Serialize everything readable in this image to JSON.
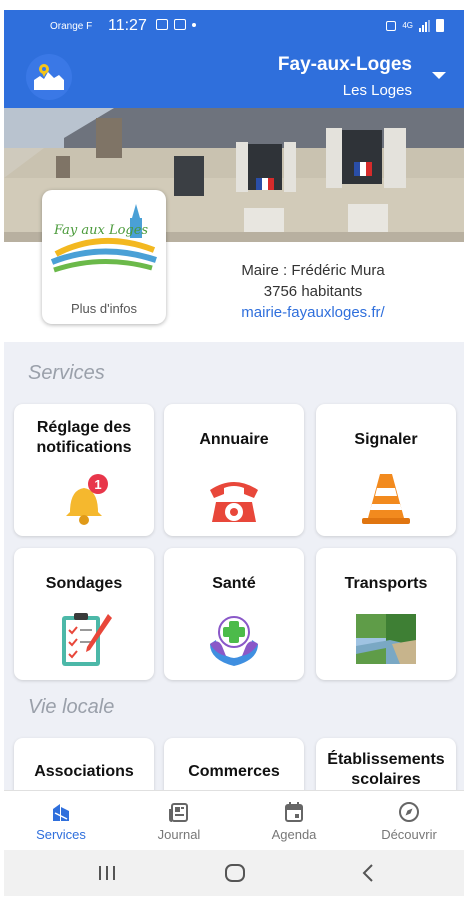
{
  "status_bar": {
    "carrier": "Orange F",
    "time": "11:27",
    "network": "4G"
  },
  "header": {
    "city": "Fay-aux-Loges",
    "subtitle": "Les Loges",
    "accent_color": "#2f6fdc"
  },
  "commune": {
    "logo_text": "Fay aux Loges",
    "more_info_label": "Plus d'infos",
    "mayor": "Maire : Frédéric Mura",
    "population": "3756 habitants",
    "website": "mairie-fayauxloges.fr/"
  },
  "services": {
    "title": "Services",
    "tiles": [
      {
        "label": "Réglage des notifications",
        "icon": "bell-icon",
        "badge": "1"
      },
      {
        "label": "Annuaire",
        "icon": "telephone-icon"
      },
      {
        "label": "Signaler",
        "icon": "traffic-cone-icon"
      },
      {
        "label": "Sondages",
        "icon": "clipboard-icon"
      },
      {
        "label": "Santé",
        "icon": "health-cross-icon"
      },
      {
        "label": "Transports",
        "icon": "canal-photo-icon"
      }
    ]
  },
  "vie_locale": {
    "title": "Vie locale",
    "tiles": [
      {
        "label": "Associations"
      },
      {
        "label": "Commerces"
      },
      {
        "label": "Établissements scolaires"
      }
    ]
  },
  "bottom_nav": [
    {
      "label": "Services",
      "icon": "services-icon",
      "active": true
    },
    {
      "label": "Journal",
      "icon": "newspaper-icon",
      "active": false
    },
    {
      "label": "Agenda",
      "icon": "calendar-icon",
      "active": false
    },
    {
      "label": "Découvrir",
      "icon": "compass-icon",
      "active": false
    }
  ]
}
